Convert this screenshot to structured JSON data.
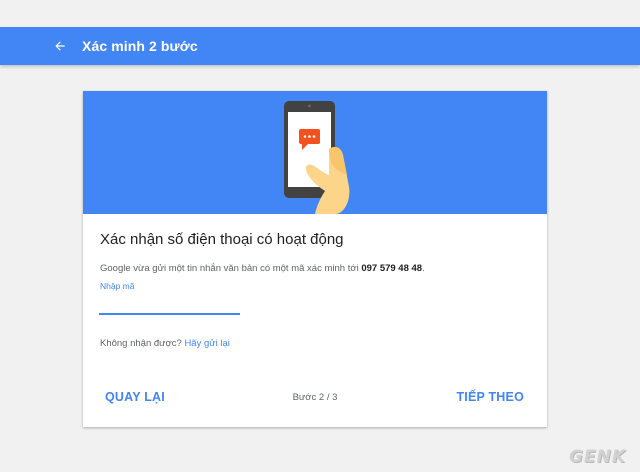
{
  "appbar": {
    "title": "Xác minh 2 bước",
    "back_icon": "arrow-back-icon"
  },
  "hero": {
    "illustration": "phone-in-hand-with-message-icon",
    "colors": {
      "background": "#4285f4",
      "phone": "#424242",
      "screen": "#ffffff",
      "bubble": "#f4511e",
      "hand": "#fdd58a"
    }
  },
  "content": {
    "heading": "Xác nhận số điện thoại có hoạt động",
    "description": "Google vừa gửi một tin nhắn văn bản có một mã xác minh tới ",
    "phone_number": "097 579 48 48",
    "phone_suffix": ".",
    "code_label": "Nhập mã",
    "code_value": "",
    "resend_prompt": "Không nhận được?",
    "resend_link": "Hãy gửi lại"
  },
  "footer": {
    "back_label": "QUAY LẠI",
    "step_label": "Bước 2 / 3",
    "next_label": "TIẾP THEO"
  },
  "watermark": "GENK",
  "colors": {
    "accent": "#4285f4",
    "page_bg": "#f1f1f1"
  }
}
